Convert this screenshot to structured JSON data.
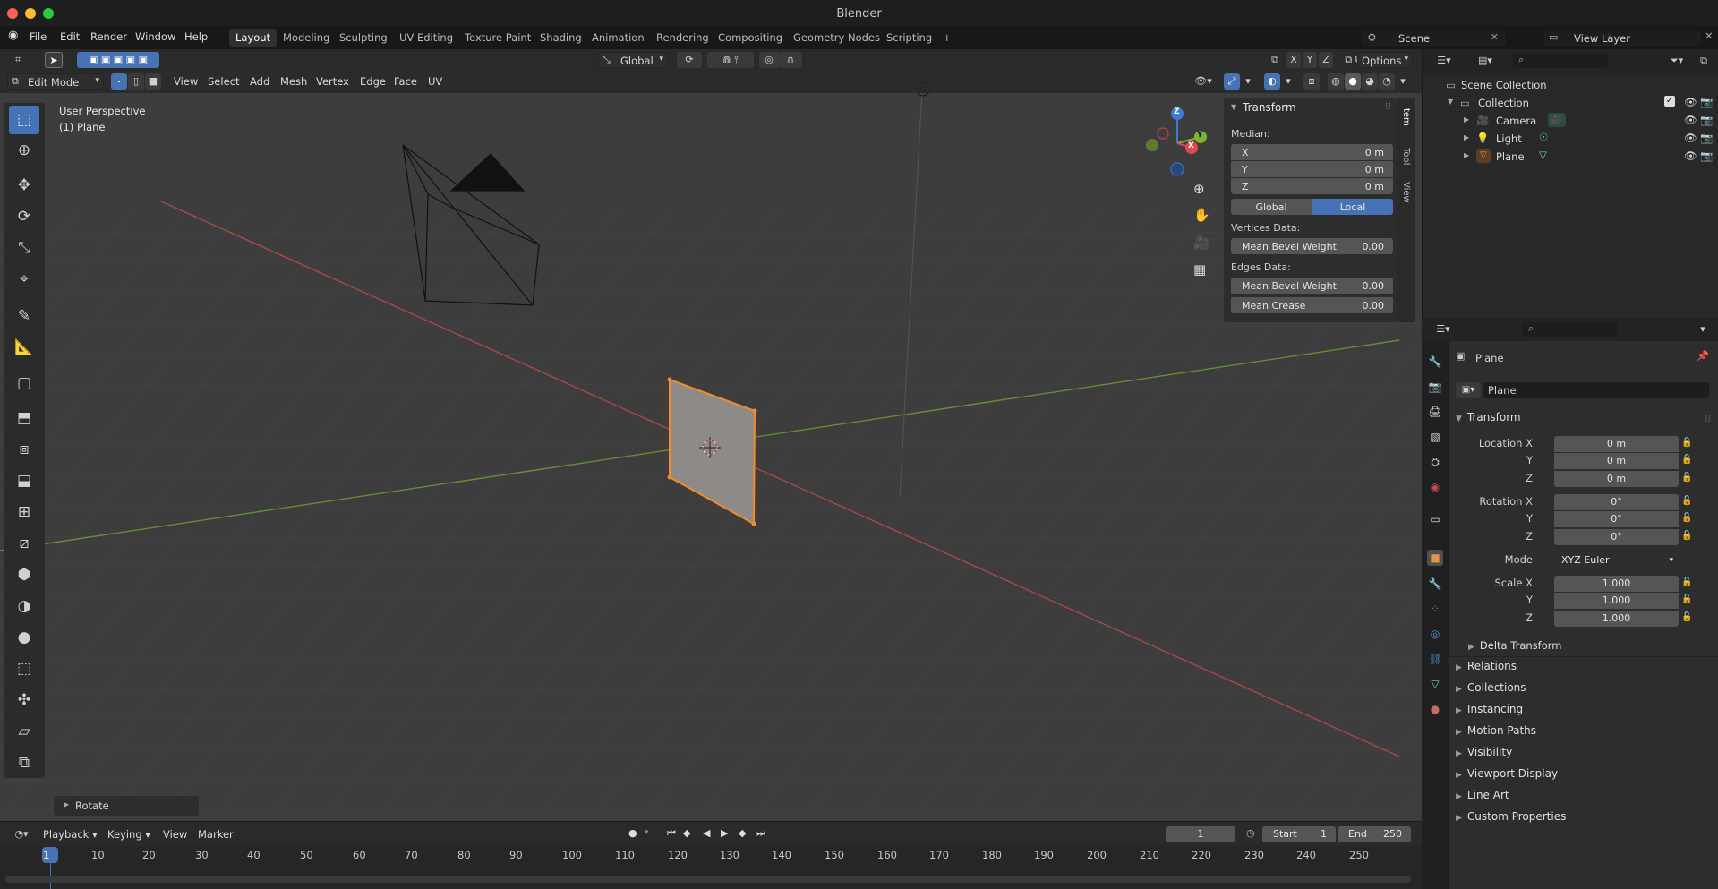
{
  "window": {
    "title": "Blender"
  },
  "menu": {
    "file": "File",
    "edit": "Edit",
    "render": "Render",
    "window": "Window",
    "help": "Help"
  },
  "workspaces": [
    {
      "label": "Layout",
      "active": true
    },
    {
      "label": "Modeling"
    },
    {
      "label": "Sculpting"
    },
    {
      "label": "UV Editing"
    },
    {
      "label": "Texture Paint"
    },
    {
      "label": "Shading"
    },
    {
      "label": "Animation"
    },
    {
      "label": "Rendering"
    },
    {
      "label": "Compositing"
    },
    {
      "label": "Geometry Nodes"
    },
    {
      "label": "Scripting"
    }
  ],
  "add_workspace": "+",
  "scene": {
    "name": "Scene",
    "view_layer": "View Layer"
  },
  "viewport": {
    "transform_orientation": "Global",
    "axis_x": "X",
    "axis_y": "Y",
    "axis_z": "Z",
    "options": "Options",
    "mode": "Edit Mode",
    "header_menus": [
      "View",
      "Select",
      "Add",
      "Mesh",
      "Vertex",
      "Edge",
      "Face",
      "UV"
    ],
    "perspective_label": "User Perspective",
    "object_label": "(1) Plane",
    "gizmo_z": "Z",
    "gizmo_y": "Y",
    "gizmo_x": "X",
    "last_op": "Rotate"
  },
  "npanel": {
    "title": "Transform",
    "median": "Median:",
    "x_label": "X",
    "x_val": "0 m",
    "y_label": "Y",
    "y_val": "0 m",
    "z_label": "Z",
    "z_val": "0 m",
    "global": "Global",
    "local": "Local",
    "vertices_data": "Vertices Data:",
    "mean_bevel_weight": "Mean Bevel Weight",
    "vert_bevel_val": "0.00",
    "edges_data": "Edges Data:",
    "edge_bevel_val": "0.00",
    "mean_crease": "Mean Crease",
    "crease_val": "0.00",
    "tabs": [
      "Item",
      "Tool",
      "View"
    ]
  },
  "outliner": {
    "scene_collection": "Scene Collection",
    "collection": "Collection",
    "items": [
      "Camera",
      "Light",
      "Plane"
    ]
  },
  "properties": {
    "object_name": "Plane",
    "data_name": "Plane",
    "transform": "Transform",
    "location_x": "Location X",
    "loc_x": "0 m",
    "y": "Y",
    "loc_y": "0 m",
    "z": "Z",
    "loc_z": "0 m",
    "rotation_x": "Rotation X",
    "rot_x": "0°",
    "rot_y": "0°",
    "rot_z": "0°",
    "mode_label": "Mode",
    "mode_val": "XYZ Euler",
    "scale_x": "Scale X",
    "sc_x": "1.000",
    "sc_y": "1.000",
    "sc_z": "1.000",
    "delta": "Delta Transform",
    "sections": [
      "Relations",
      "Collections",
      "Instancing",
      "Motion Paths",
      "Visibility",
      "Viewport Display",
      "Line Art",
      "Custom Properties"
    ]
  },
  "timeline": {
    "playback": "Playback",
    "keying": "Keying",
    "view": "View",
    "marker": "Marker",
    "current_frame": "1",
    "start_label": "Start",
    "start": "1",
    "end_label": "End",
    "end": "250",
    "ticks": [
      "1",
      "10",
      "20",
      "30",
      "40",
      "50",
      "60",
      "70",
      "80",
      "90",
      "100",
      "110",
      "120",
      "130",
      "140",
      "150",
      "160",
      "170",
      "180",
      "190",
      "200",
      "210",
      "220",
      "230",
      "240",
      "250"
    ]
  }
}
